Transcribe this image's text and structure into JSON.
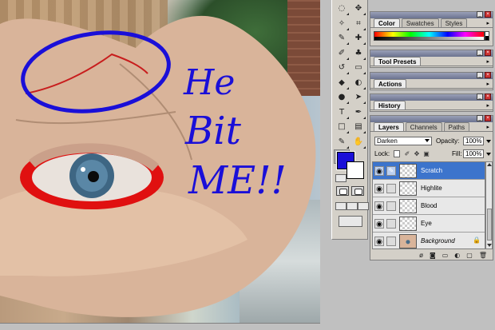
{
  "canvas": {
    "annotation_text_line1": "He",
    "annotation_text_line2": "Bit",
    "annotation_text_line3": "ME!!"
  },
  "toolbox": {
    "tools": [
      {
        "name": "lasso-tool",
        "glyph": "◌"
      },
      {
        "name": "move-tool",
        "glyph": "✥"
      },
      {
        "name": "magic-wand-tool",
        "glyph": "✧"
      },
      {
        "name": "crop-tool",
        "glyph": "⌗"
      },
      {
        "name": "slice-tool",
        "glyph": "✎"
      },
      {
        "name": "healing-brush-tool",
        "glyph": "✚"
      },
      {
        "name": "brush-tool",
        "glyph": "✐"
      },
      {
        "name": "clone-stamp-tool",
        "glyph": "♣"
      },
      {
        "name": "history-brush-tool",
        "glyph": "↺"
      },
      {
        "name": "eraser-tool",
        "glyph": "▭"
      },
      {
        "name": "paint-bucket-tool",
        "glyph": "◆"
      },
      {
        "name": "blur-tool",
        "glyph": "◐"
      },
      {
        "name": "dodge-tool",
        "glyph": "●"
      },
      {
        "name": "path-selection-tool",
        "glyph": "➤"
      },
      {
        "name": "type-tool",
        "glyph": "T"
      },
      {
        "name": "pen-tool",
        "glyph": "✒"
      },
      {
        "name": "shape-tool",
        "glyph": "□"
      },
      {
        "name": "notes-tool",
        "glyph": "▤"
      },
      {
        "name": "eyedropper-tool",
        "glyph": "✎"
      },
      {
        "name": "hand-tool",
        "glyph": "✋"
      },
      {
        "name": "zoom-tool",
        "glyph": "🔍"
      }
    ],
    "foreground_color": "#1a0fd8",
    "background_color": "#ffffff"
  },
  "palettes": {
    "color": {
      "tabs": [
        "Color",
        "Swatches",
        "Styles"
      ],
      "active": "Color"
    },
    "tool_presets": {
      "tabs": [
        "Tool Presets"
      ]
    },
    "actions": {
      "tabs": [
        "Actions"
      ]
    },
    "history": {
      "tabs": [
        "History"
      ]
    },
    "layers": {
      "tabs": [
        "Layers",
        "Channels",
        "Paths"
      ],
      "blend_mode": "Darken",
      "opacity_label": "Opacity:",
      "opacity_value": "100%",
      "lock_label": "Lock:",
      "fill_label": "Fill:",
      "fill_value": "100%",
      "items": [
        {
          "name": "Scratch",
          "selected": true
        },
        {
          "name": "Highlite",
          "selected": false
        },
        {
          "name": "Blood",
          "selected": false
        },
        {
          "name": "Eye",
          "selected": false
        },
        {
          "name": "Background",
          "selected": false,
          "locked": true
        }
      ]
    }
  },
  "colors": {
    "annotation_blue": "#1a0fd8",
    "blood_red": "#e01010",
    "selection_blue": "#3c74cc"
  }
}
